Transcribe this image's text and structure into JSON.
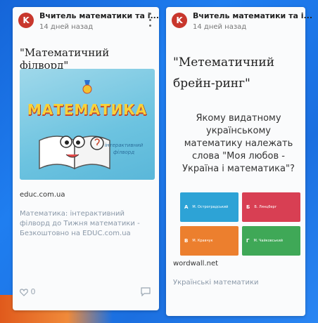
{
  "left_card": {
    "avatar_letter": "K",
    "author": "Вчитель математики та і...",
    "time": "14 дней назад",
    "title": "\"Математичний філворд\"",
    "thumb_word": "МАТЕМАТИКА",
    "thumb_sub": "інтерактивний філворд",
    "source": "educ.com.ua",
    "description": "Математика: інтерактивний філворд до Тижня математики - Безкоштовно на EDUC.com.ua",
    "likes": "0"
  },
  "right_card": {
    "avatar_letter": "K",
    "author": "Вчитель математики та і...",
    "time": "14 дней назад",
    "title": "\"Метематичний брейн-ринг\"",
    "question": "Якому видатному українському математику належать слова \"Моя любов - Україна і математика\"?",
    "tiles": [
      {
        "letter": "A",
        "label": "М. Остроградський",
        "color": "#2da3d6"
      },
      {
        "letter": "Б",
        "label": "В. Лянцберг",
        "color": "#d83f53"
      },
      {
        "letter": "В",
        "label": "М. Кравчук",
        "color": "#ec7f2e"
      },
      {
        "letter": "Г",
        "label": "М. Чайковський",
        "color": "#3fa857"
      }
    ],
    "source": "wordwall.net",
    "description": "Українські математики"
  },
  "colors": {
    "avatar": "#c8372d",
    "background": "#1f7ef0"
  }
}
